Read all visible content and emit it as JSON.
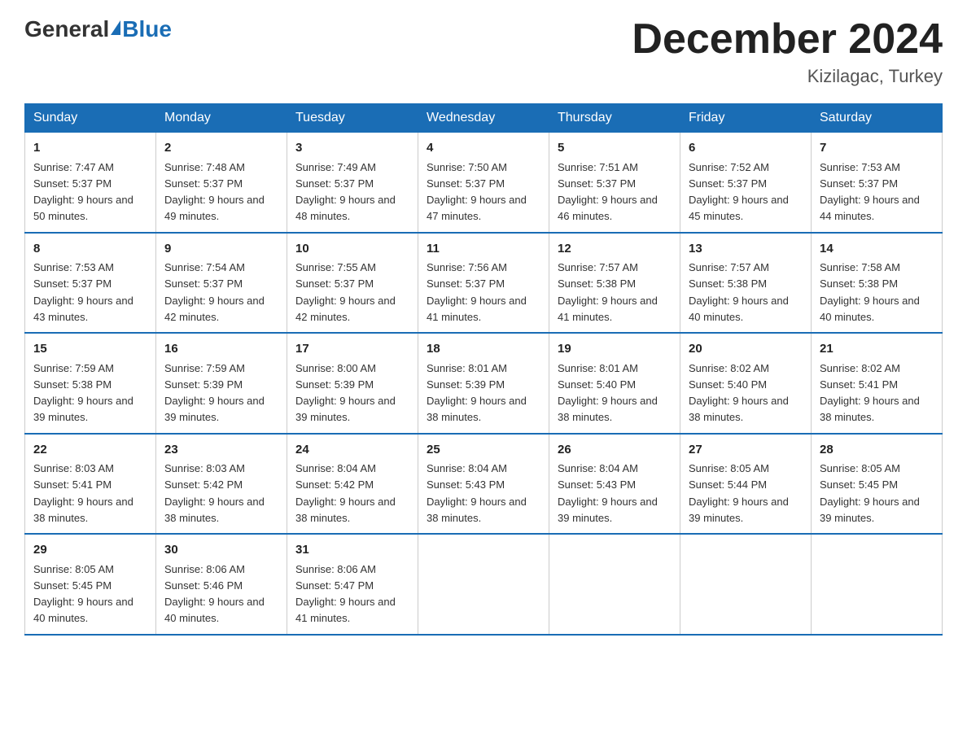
{
  "logo": {
    "general": "General",
    "blue": "Blue"
  },
  "title": "December 2024",
  "subtitle": "Kizilagac, Turkey",
  "days_of_week": [
    "Sunday",
    "Monday",
    "Tuesday",
    "Wednesday",
    "Thursday",
    "Friday",
    "Saturday"
  ],
  "weeks": [
    [
      {
        "day": 1,
        "sunrise": "7:47 AM",
        "sunset": "5:37 PM",
        "daylight": "9 hours and 50 minutes."
      },
      {
        "day": 2,
        "sunrise": "7:48 AM",
        "sunset": "5:37 PM",
        "daylight": "9 hours and 49 minutes."
      },
      {
        "day": 3,
        "sunrise": "7:49 AM",
        "sunset": "5:37 PM",
        "daylight": "9 hours and 48 minutes."
      },
      {
        "day": 4,
        "sunrise": "7:50 AM",
        "sunset": "5:37 PM",
        "daylight": "9 hours and 47 minutes."
      },
      {
        "day": 5,
        "sunrise": "7:51 AM",
        "sunset": "5:37 PM",
        "daylight": "9 hours and 46 minutes."
      },
      {
        "day": 6,
        "sunrise": "7:52 AM",
        "sunset": "5:37 PM",
        "daylight": "9 hours and 45 minutes."
      },
      {
        "day": 7,
        "sunrise": "7:53 AM",
        "sunset": "5:37 PM",
        "daylight": "9 hours and 44 minutes."
      }
    ],
    [
      {
        "day": 8,
        "sunrise": "7:53 AM",
        "sunset": "5:37 PM",
        "daylight": "9 hours and 43 minutes."
      },
      {
        "day": 9,
        "sunrise": "7:54 AM",
        "sunset": "5:37 PM",
        "daylight": "9 hours and 42 minutes."
      },
      {
        "day": 10,
        "sunrise": "7:55 AM",
        "sunset": "5:37 PM",
        "daylight": "9 hours and 42 minutes."
      },
      {
        "day": 11,
        "sunrise": "7:56 AM",
        "sunset": "5:37 PM",
        "daylight": "9 hours and 41 minutes."
      },
      {
        "day": 12,
        "sunrise": "7:57 AM",
        "sunset": "5:38 PM",
        "daylight": "9 hours and 41 minutes."
      },
      {
        "day": 13,
        "sunrise": "7:57 AM",
        "sunset": "5:38 PM",
        "daylight": "9 hours and 40 minutes."
      },
      {
        "day": 14,
        "sunrise": "7:58 AM",
        "sunset": "5:38 PM",
        "daylight": "9 hours and 40 minutes."
      }
    ],
    [
      {
        "day": 15,
        "sunrise": "7:59 AM",
        "sunset": "5:38 PM",
        "daylight": "9 hours and 39 minutes."
      },
      {
        "day": 16,
        "sunrise": "7:59 AM",
        "sunset": "5:39 PM",
        "daylight": "9 hours and 39 minutes."
      },
      {
        "day": 17,
        "sunrise": "8:00 AM",
        "sunset": "5:39 PM",
        "daylight": "9 hours and 39 minutes."
      },
      {
        "day": 18,
        "sunrise": "8:01 AM",
        "sunset": "5:39 PM",
        "daylight": "9 hours and 38 minutes."
      },
      {
        "day": 19,
        "sunrise": "8:01 AM",
        "sunset": "5:40 PM",
        "daylight": "9 hours and 38 minutes."
      },
      {
        "day": 20,
        "sunrise": "8:02 AM",
        "sunset": "5:40 PM",
        "daylight": "9 hours and 38 minutes."
      },
      {
        "day": 21,
        "sunrise": "8:02 AM",
        "sunset": "5:41 PM",
        "daylight": "9 hours and 38 minutes."
      }
    ],
    [
      {
        "day": 22,
        "sunrise": "8:03 AM",
        "sunset": "5:41 PM",
        "daylight": "9 hours and 38 minutes."
      },
      {
        "day": 23,
        "sunrise": "8:03 AM",
        "sunset": "5:42 PM",
        "daylight": "9 hours and 38 minutes."
      },
      {
        "day": 24,
        "sunrise": "8:04 AM",
        "sunset": "5:42 PM",
        "daylight": "9 hours and 38 minutes."
      },
      {
        "day": 25,
        "sunrise": "8:04 AM",
        "sunset": "5:43 PM",
        "daylight": "9 hours and 38 minutes."
      },
      {
        "day": 26,
        "sunrise": "8:04 AM",
        "sunset": "5:43 PM",
        "daylight": "9 hours and 39 minutes."
      },
      {
        "day": 27,
        "sunrise": "8:05 AM",
        "sunset": "5:44 PM",
        "daylight": "9 hours and 39 minutes."
      },
      {
        "day": 28,
        "sunrise": "8:05 AM",
        "sunset": "5:45 PM",
        "daylight": "9 hours and 39 minutes."
      }
    ],
    [
      {
        "day": 29,
        "sunrise": "8:05 AM",
        "sunset": "5:45 PM",
        "daylight": "9 hours and 40 minutes."
      },
      {
        "day": 30,
        "sunrise": "8:06 AM",
        "sunset": "5:46 PM",
        "daylight": "9 hours and 40 minutes."
      },
      {
        "day": 31,
        "sunrise": "8:06 AM",
        "sunset": "5:47 PM",
        "daylight": "9 hours and 41 minutes."
      },
      null,
      null,
      null,
      null
    ]
  ]
}
